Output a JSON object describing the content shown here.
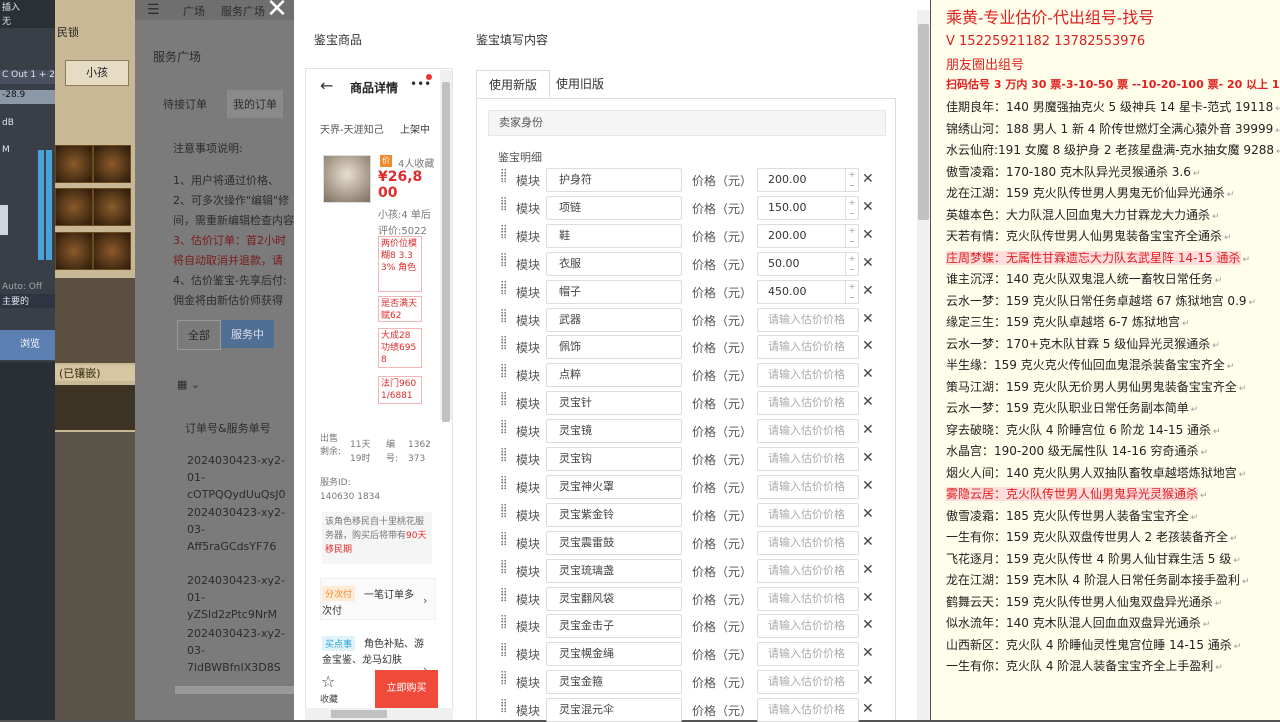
{
  "daw": {
    "insert_label": "插入",
    "insert_value": "无",
    "out_label": "C Out 1 + 2",
    "db_label": "dB",
    "auto_label": "Auto: Off",
    "mix_label": "主要的",
    "browse_label": "浏览",
    "meter_vals": "-28.9",
    "m_label": "M"
  },
  "game": {
    "title": "民锁",
    "tab": "小孩",
    "embedded_label": "(已镶嵌)"
  },
  "bg_app": {
    "breadcrumb_1": "广场",
    "breadcrumb_2": "服务广场",
    "section_title": "服务广场",
    "tab_pending": "待接订单",
    "tab_mine": "我的订单",
    "notice_title": "注意事项说明:",
    "notice_1": "1、用户将通过价格、",
    "notice_2": "2、可多次操作\"编辑\"修",
    "notice_3": "间，需重新编辑检查内容",
    "notice_4": "3、估价订单：首2小时",
    "notice_5": "将自动取消并退款，请",
    "notice_6": "4、估价鉴宝-先享后付:",
    "notice_7": "佣金将由新估价师获得",
    "filter_all": "全部",
    "filter_active": "服务中",
    "col_header": "订单号&服务单号",
    "orders": [
      {
        "a": "2024030423-xy2-",
        "b": "01-",
        "c": "cOTPQQydUuQsJ0"
      },
      {
        "a": "2024030423-xy2-",
        "b": "03-",
        "c": "Aff5raGCdsYF76"
      },
      {
        "a": "2024030423-xy2-",
        "b": "01-",
        "c": "yZSld2zPtc9NrM"
      },
      {
        "a": "2024030423-xy2-",
        "b": "03-",
        "c": "7ldBWBfnIX3D8S"
      }
    ]
  },
  "modal": {
    "left_heading": "鉴宝商品",
    "right_heading": "鉴宝填写内容",
    "close_icon": "close-icon"
  },
  "product": {
    "header_title": "商品详情",
    "server": "天界-天涯知己",
    "status": "上架中",
    "badge": "价",
    "favorites": "4人收藏",
    "price": "¥26,800",
    "kid_label": "小孩:4 单后",
    "rating": "评价:5022",
    "tags": [
      "两价位模糊8 3.33% 角色",
      "是否满天赋62",
      "大成28功绩6958",
      "法门9601/6881"
    ],
    "time_label": "出售剩余:",
    "time_value": "11天19时",
    "id_label": "编号:",
    "id_value": "1362373",
    "server_id": "服务ID: 140630 1834",
    "desc": "该角色移民自十里桃花服务器，购买后将带有",
    "desc_red": "90天移民期",
    "pay_tag": "分次付",
    "pay_text": "一笔订单多次付",
    "insurance_tag": "买点事",
    "insurance_text": "角色补贴、游金宝鉴、龙马幻肤",
    "fav_label": "收藏",
    "buy_label": "立即购买"
  },
  "form": {
    "tab_new": "使用新版",
    "tab_old": "使用旧版",
    "seller_section": "卖家身份",
    "detail_label": "鉴宝明细",
    "module_label": "模块",
    "price_label": "价格（元）",
    "placeholder": "请输入估价价格",
    "rows": [
      {
        "name": "护身符",
        "price": "200.00"
      },
      {
        "name": "项链",
        "price": "150.00"
      },
      {
        "name": "鞋",
        "price": "200.00"
      },
      {
        "name": "衣服",
        "price": "50.00"
      },
      {
        "name": "帽子",
        "price": "450.00"
      },
      {
        "name": "武器",
        "price": ""
      },
      {
        "name": "佩饰",
        "price": ""
      },
      {
        "name": "点粹",
        "price": ""
      },
      {
        "name": "灵宝针",
        "price": ""
      },
      {
        "name": "灵宝镜",
        "price": ""
      },
      {
        "name": "灵宝钩",
        "price": ""
      },
      {
        "name": "灵宝神火罩",
        "price": ""
      },
      {
        "name": "灵宝紫金铃",
        "price": ""
      },
      {
        "name": "灵宝震雷鼓",
        "price": ""
      },
      {
        "name": "灵宝琉璃盏",
        "price": ""
      },
      {
        "name": "灵宝翻风袋",
        "price": ""
      },
      {
        "name": "灵宝金击子",
        "price": ""
      },
      {
        "name": "灵宝幌金绳",
        "price": ""
      },
      {
        "name": "灵宝金箍",
        "price": ""
      },
      {
        "name": "灵宝混元伞",
        "price": ""
      }
    ]
  },
  "notes": {
    "title": "乘黄-专业估价-代出组号-找号",
    "phone": "V 15225921182   13782553976",
    "moments": "朋友圈出组号",
    "pricing": "扫码估号 3 万内 30 票-3-10-50 票 --10-20-100 票- 20 以上 150",
    "lines": [
      {
        "text": "佳期良年：140 男魔强抽克火 5 级神兵 14 星卡-范式 19118",
        "red": false
      },
      {
        "text": "锦绣山河：188 男人 1 新 4 阶传世燃灯全满心猿外音 39999",
        "red": false
      },
      {
        "text": "水云仙府:191 女魔 8 级护身 2 老孩星盘满-克水抽女魔 9288",
        "red": false
      },
      {
        "text": "傲雪凌霜：170-180 克木队异光灵猴通杀 3.6",
        "red": false
      },
      {
        "text": "龙在江湖：159 克火队传世男人男鬼无价仙异光通杀",
        "red": false
      },
      {
        "text": "英雄本色：大力队混人回血鬼大力甘霖龙大力通杀",
        "red": false
      },
      {
        "text": "天若有情：克火队传世男人仙男鬼装备宝宝齐全通杀",
        "red": false
      },
      {
        "text": "庄周梦蝶：无属性甘霖遗忘大力队玄武星阵 14-15 通杀",
        "red": true
      },
      {
        "text": "谁主沉浮：140 克火队双鬼混人统一畜牧日常任务",
        "red": false
      },
      {
        "text": "云水一梦：159 克火队日常任务卓越塔 67 炼狱地宫 0.9",
        "red": false
      },
      {
        "text": "缘定三生：159 克火队卓越塔 6-7 炼狱地宫",
        "red": false
      },
      {
        "text": "云水一梦：170+克木队甘霖 5 级仙异光灵猴通杀",
        "red": false
      },
      {
        "text": "半生缘：159 克火克火传仙回血鬼混杀装备宝宝齐全",
        "red": false
      },
      {
        "text": "策马江湖：159 克火队无价男人男仙男鬼装备宝宝齐全",
        "red": false
      },
      {
        "text": "云水一梦：159 克火队职业日常任务副本简单",
        "red": false
      },
      {
        "text": "穿去破晓：克火队 4 阶睡宫位 6 阶龙 14-15 通杀",
        "red": false
      },
      {
        "text": "水晶宫：190-200 级无属性队 14-16 穷奇通杀",
        "red": false
      },
      {
        "text": "烟火人间：140 克火队男人双抽队畜牧卓越塔炼狱地宫",
        "red": false
      },
      {
        "text": "雾隐云居：克火队传世男人仙男鬼异光灵猴通杀",
        "red": true
      },
      {
        "text": "傲雪凌霜：185 克火队传世男人装备宝宝齐全",
        "red": false
      },
      {
        "text": "一生有你：159 克火队双盘传世男人 2 老孩装备齐全",
        "red": false
      },
      {
        "text": "飞花逐月：159 克火队传世 4 阶男人仙甘霖生活 5 级",
        "red": false
      },
      {
        "text": "龙在江湖：159 克木队 4 阶混人日常任务副本接手盈利",
        "red": false
      },
      {
        "text": "鹤舞云天：159 克火队传世男人仙鬼双盘异光通杀",
        "red": false
      },
      {
        "text": "似水流年：140 克木队混人回血血双盘异光通杀",
        "red": false
      },
      {
        "text": "山西新区：克火队 4 阶睡仙灵性鬼宫位睡 14-15 通杀",
        "red": false
      },
      {
        "text": "一生有你：克火队 4 阶混人装备宝宝齐全上手盈利",
        "red": false
      }
    ]
  }
}
